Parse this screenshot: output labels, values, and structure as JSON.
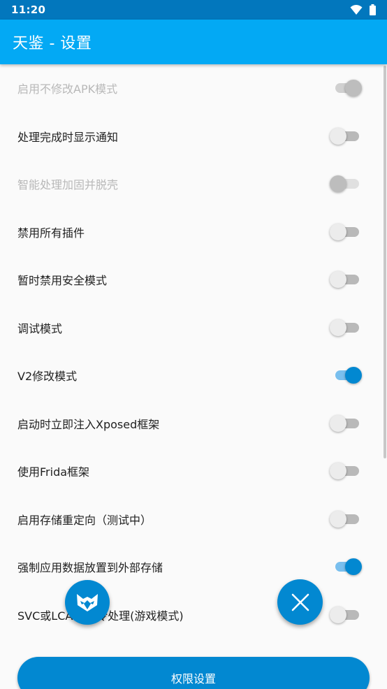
{
  "status_bar": {
    "time": "11:20",
    "icons": [
      "wifi-icon",
      "battery-icon"
    ]
  },
  "app_bar": {
    "title": "天鉴 - 设置"
  },
  "settings": [
    {
      "label": "启用不修改APK模式",
      "enabled": false,
      "checked": true
    },
    {
      "label": "处理完成时显示通知",
      "enabled": true,
      "checked": false
    },
    {
      "label": "智能处理加固并脱壳",
      "enabled": false,
      "checked": false
    },
    {
      "label": "禁用所有插件",
      "enabled": true,
      "checked": false
    },
    {
      "label": "暂时禁用安全模式",
      "enabled": true,
      "checked": false
    },
    {
      "label": "调试模式",
      "enabled": true,
      "checked": false
    },
    {
      "label": "V2修改模式",
      "enabled": true,
      "checked": true
    },
    {
      "label": "启动时立即注入Xposed框架",
      "enabled": true,
      "checked": false
    },
    {
      "label": "使用Frida框架",
      "enabled": true,
      "checked": false
    },
    {
      "label": "启用存储重定向（测试中）",
      "enabled": true,
      "checked": false
    },
    {
      "label": "强制应用数据放置到外部存储",
      "enabled": true,
      "checked": true
    },
    {
      "label": "SVC或LCALL指令处理(游戏模式)",
      "enabled": true,
      "checked": false
    }
  ],
  "fabs": {
    "left_icon": "fox-logo-icon",
    "right_icon": "close-icon"
  },
  "permission_button": {
    "label": "权限设置"
  },
  "colors": {
    "status_bar": "#0277bd",
    "app_bar": "#03a9f4",
    "accent": "#0288d1",
    "switch_on_track": "#79bfee"
  }
}
